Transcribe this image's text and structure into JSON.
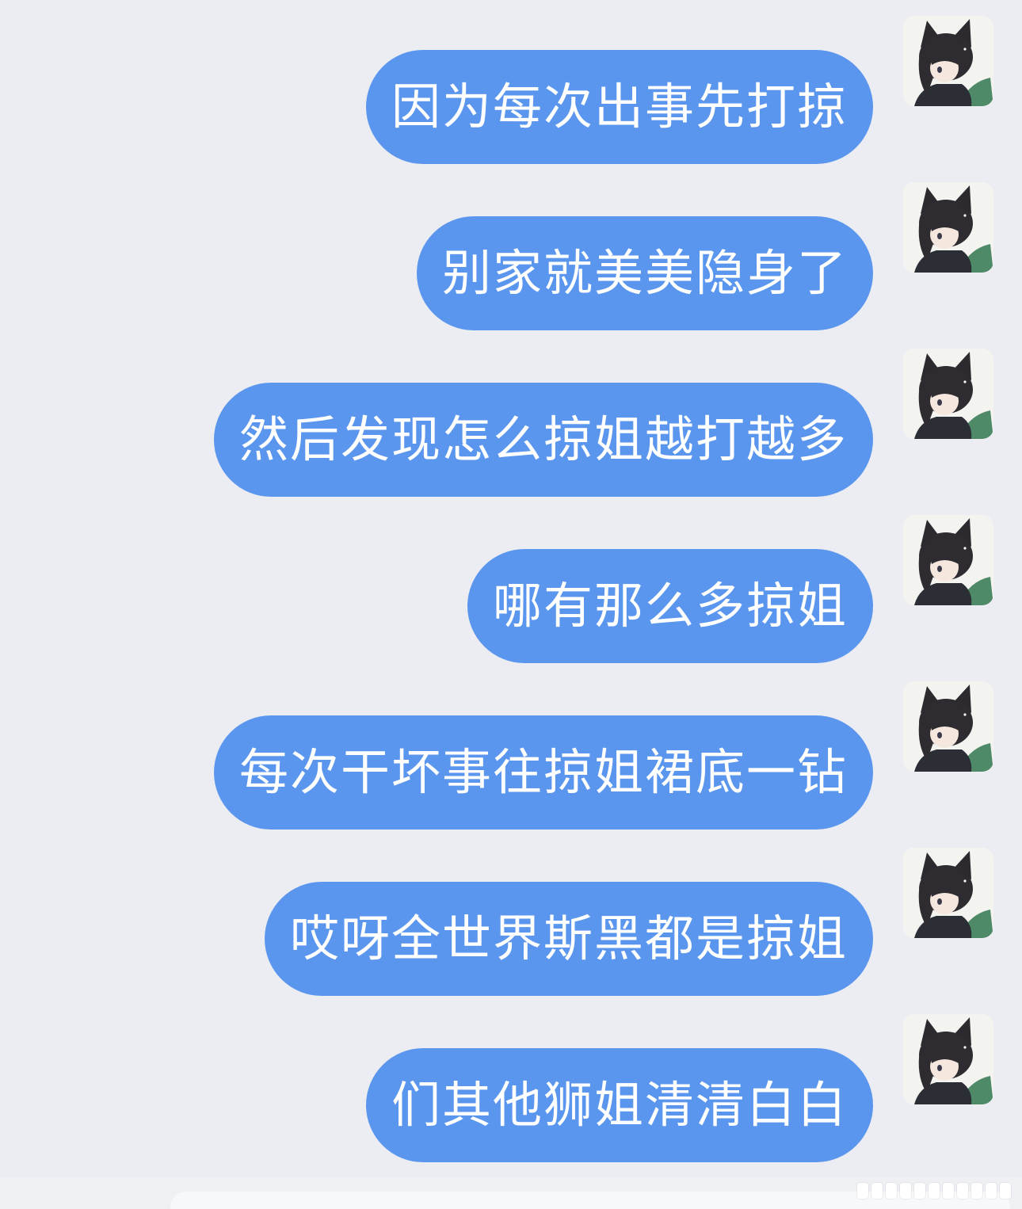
{
  "messages": [
    {
      "text": "因为每次出事先打掠",
      "avatar": "cat-eared-girl-avatar"
    },
    {
      "text": "别家就美美隐身了",
      "avatar": "cat-eared-girl-avatar"
    },
    {
      "text": "然后发现怎么掠姐越打越多",
      "avatar": "cat-eared-girl-avatar"
    },
    {
      "text": "哪有那么多掠姐",
      "avatar": "cat-eared-girl-avatar"
    },
    {
      "text": "每次干坏事往掠姐裙底一钻",
      "avatar": "cat-eared-girl-avatar"
    },
    {
      "text": "哎呀全世界斯黑都是掠姐",
      "avatar": "cat-eared-girl-avatar"
    },
    {
      "text": "们其他狮姐清清白白",
      "avatar": "cat-eared-girl-avatar"
    }
  ],
  "colors": {
    "background": "#ecedf2",
    "bubble": "#5b96ee",
    "bubble_text": "#ffffff"
  }
}
